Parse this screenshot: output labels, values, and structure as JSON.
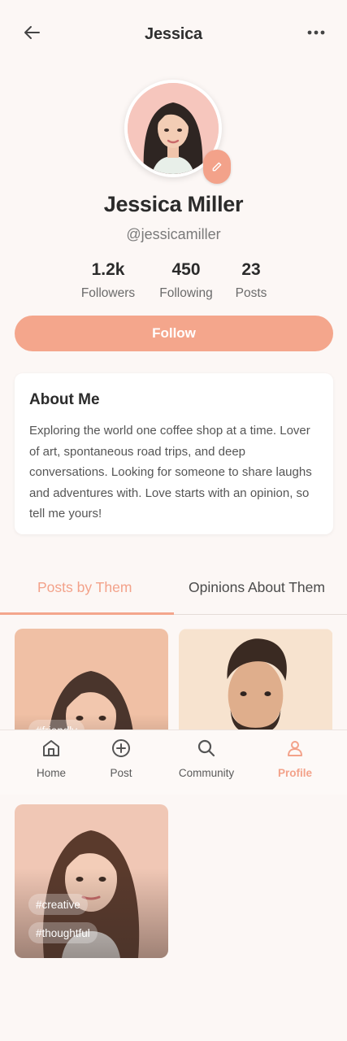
{
  "header": {
    "title": "Jessica"
  },
  "profile": {
    "name": "Jessica Miller",
    "handle": "@jessicamiller"
  },
  "stats": [
    {
      "value": "1.2k",
      "label": "Followers"
    },
    {
      "value": "450",
      "label": "Following"
    },
    {
      "value": "23",
      "label": "Posts"
    }
  ],
  "follow_label": "Follow",
  "about": {
    "title": "About Me",
    "text": "Exploring the world one coffee shop at a time. Lover of art, spontaneous road trips, and deep conversations. Looking for someone to share laughs and adventures with. Love starts with an opinion, so tell me yours!"
  },
  "tabs": [
    {
      "label": "Posts by Them",
      "active": true
    },
    {
      "label": "Opinions About Them",
      "active": false
    }
  ],
  "posts": [
    {
      "tags": [
        "#friendly"
      ]
    },
    {
      "tags": []
    },
    {
      "tags": [
        "#creative",
        "#thoughtful"
      ]
    }
  ],
  "nav": [
    {
      "label": "Home",
      "icon": "home-icon"
    },
    {
      "label": "Post",
      "icon": "plus-circle-icon"
    },
    {
      "label": "Community",
      "icon": "search-icon"
    },
    {
      "label": "Profile",
      "icon": "user-icon",
      "active": true
    }
  ],
  "colors": {
    "accent": "#f4a68c",
    "background": "#fcf7f5"
  }
}
